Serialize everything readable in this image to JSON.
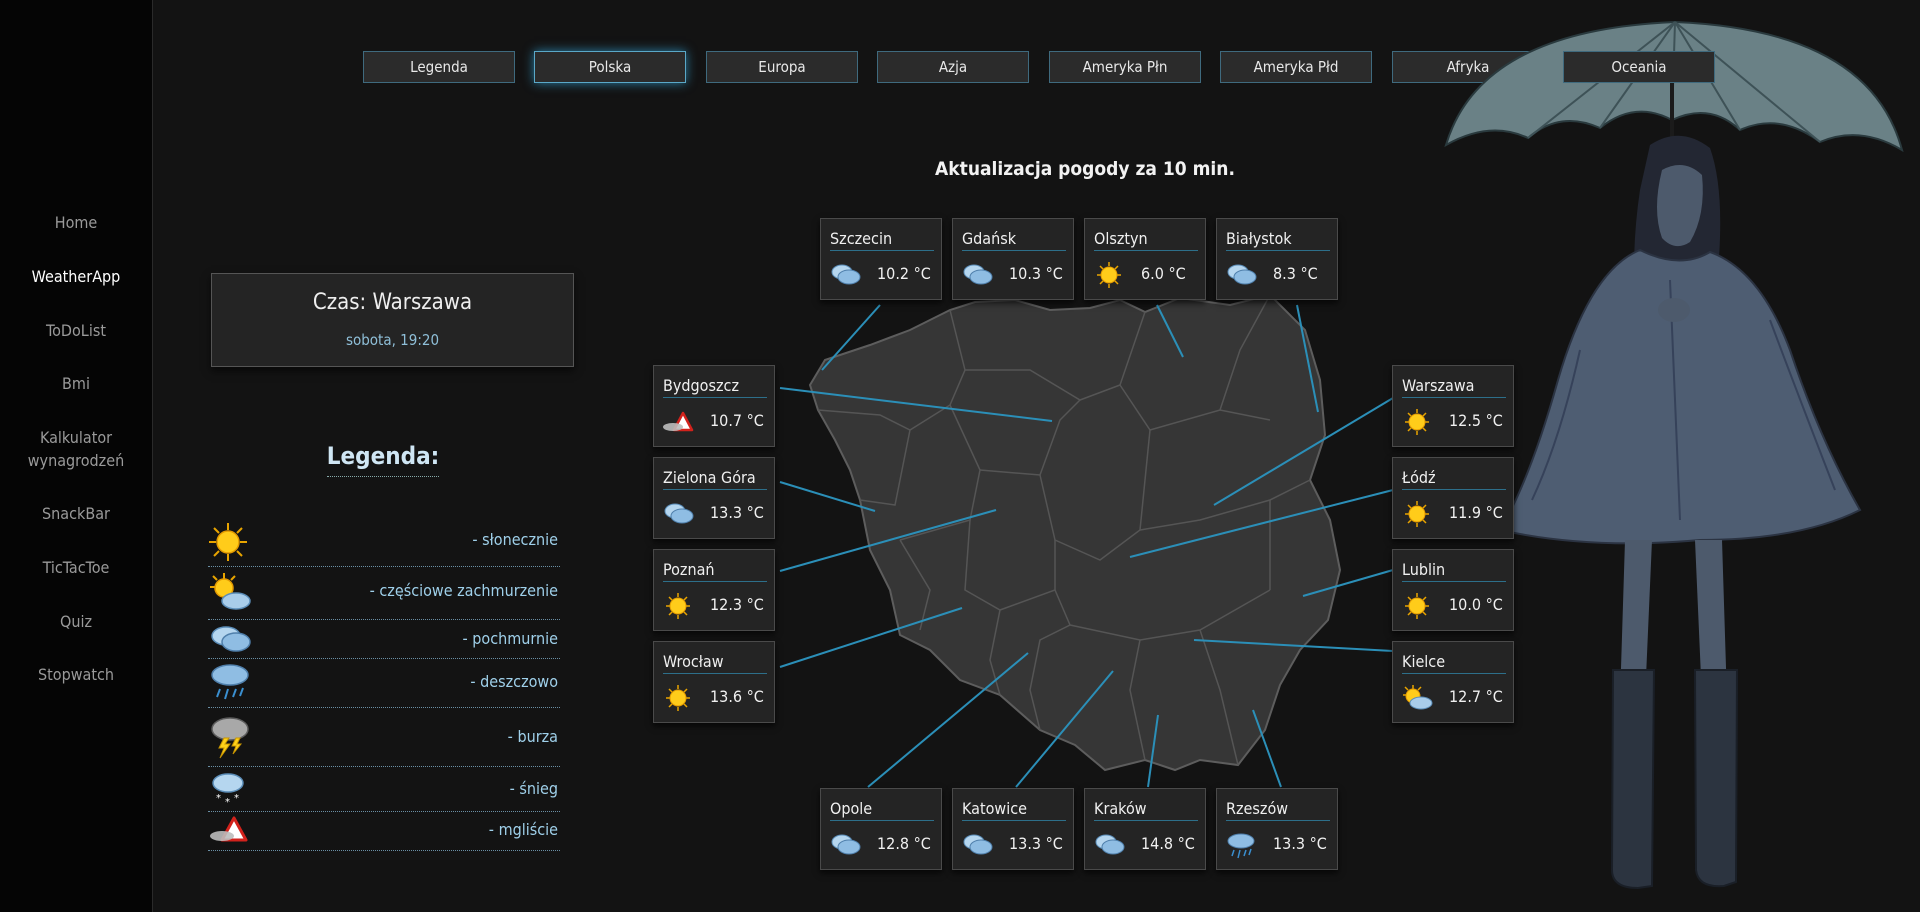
{
  "sidebar": {
    "items": [
      {
        "label": "Home"
      },
      {
        "label": "WeatherApp",
        "active": true
      },
      {
        "label": "ToDoList"
      },
      {
        "label": "Bmi"
      },
      {
        "label_line1": "Kalkulator",
        "label_line2": "wynagrodzeń"
      },
      {
        "label": "SnackBar"
      },
      {
        "label": "TicTacToe"
      },
      {
        "label": "Quiz"
      },
      {
        "label": "Stopwatch"
      }
    ]
  },
  "tabs": [
    {
      "label": "Legenda"
    },
    {
      "label": "Polska",
      "active": true
    },
    {
      "label": "Europa"
    },
    {
      "label": "Azja"
    },
    {
      "label": "Ameryka Płn"
    },
    {
      "label": "Ameryka Płd"
    },
    {
      "label": "Afryka"
    },
    {
      "label": "Oceania"
    }
  ],
  "time": {
    "title": "Czas: Warszawa",
    "date": "sobota, 19:20"
  },
  "legend": {
    "title": "Legenda:",
    "items": [
      {
        "icon": "sun-icon",
        "label": "- słonecznie"
      },
      {
        "icon": "partly-cloudy-icon",
        "label": "- częściowe zachmurzenie"
      },
      {
        "icon": "cloudy-icon",
        "label": "- pochmurnie"
      },
      {
        "icon": "rain-icon",
        "label": "- deszczowo"
      },
      {
        "icon": "storm-icon",
        "label": "- burza"
      },
      {
        "icon": "snow-icon",
        "label": "- śnieg"
      },
      {
        "icon": "fog-icon",
        "label": "- mgliście"
      }
    ]
  },
  "update_title": "Aktualizacja pogody za 10 min.",
  "cities": [
    {
      "name": "Szczecin",
      "temp": "10.2 °C",
      "icon": "cloudy-icon"
    },
    {
      "name": "Gdańsk",
      "temp": "10.3 °C",
      "icon": "cloudy-icon"
    },
    {
      "name": "Olsztyn",
      "temp": "6.0 °C",
      "icon": "sun-icon"
    },
    {
      "name": "Białystok",
      "temp": "8.3 °C",
      "icon": "cloudy-icon"
    },
    {
      "name": "Bydgoszcz",
      "temp": "10.7 °C",
      "icon": "fog-icon"
    },
    {
      "name": "Zielona Góra",
      "temp": "13.3 °C",
      "icon": "cloudy-icon"
    },
    {
      "name": "Poznań",
      "temp": "12.3 °C",
      "icon": "sun-icon"
    },
    {
      "name": "Wrocław",
      "temp": "13.6 °C",
      "icon": "sun-icon"
    },
    {
      "name": "Warszawa",
      "temp": "12.5 °C",
      "icon": "sun-icon"
    },
    {
      "name": "Łódź",
      "temp": "11.9 °C",
      "icon": "sun-icon"
    },
    {
      "name": "Lublin",
      "temp": "10.0 °C",
      "icon": "sun-icon"
    },
    {
      "name": "Kielce",
      "temp": "12.7 °C",
      "icon": "partly-cloudy-icon"
    },
    {
      "name": "Opole",
      "temp": "12.8 °C",
      "icon": "cloudy-icon"
    },
    {
      "name": "Katowice",
      "temp": "13.3 °C",
      "icon": "cloudy-icon"
    },
    {
      "name": "Kraków",
      "temp": "14.8 °C",
      "icon": "cloudy-icon"
    },
    {
      "name": "Rzeszów",
      "temp": "13.3 °C",
      "icon": "rain-icon"
    }
  ],
  "colors": {
    "accent": "#2b8fb8",
    "background": "#131313",
    "sidebar": "#050505",
    "panel": "#242424"
  }
}
